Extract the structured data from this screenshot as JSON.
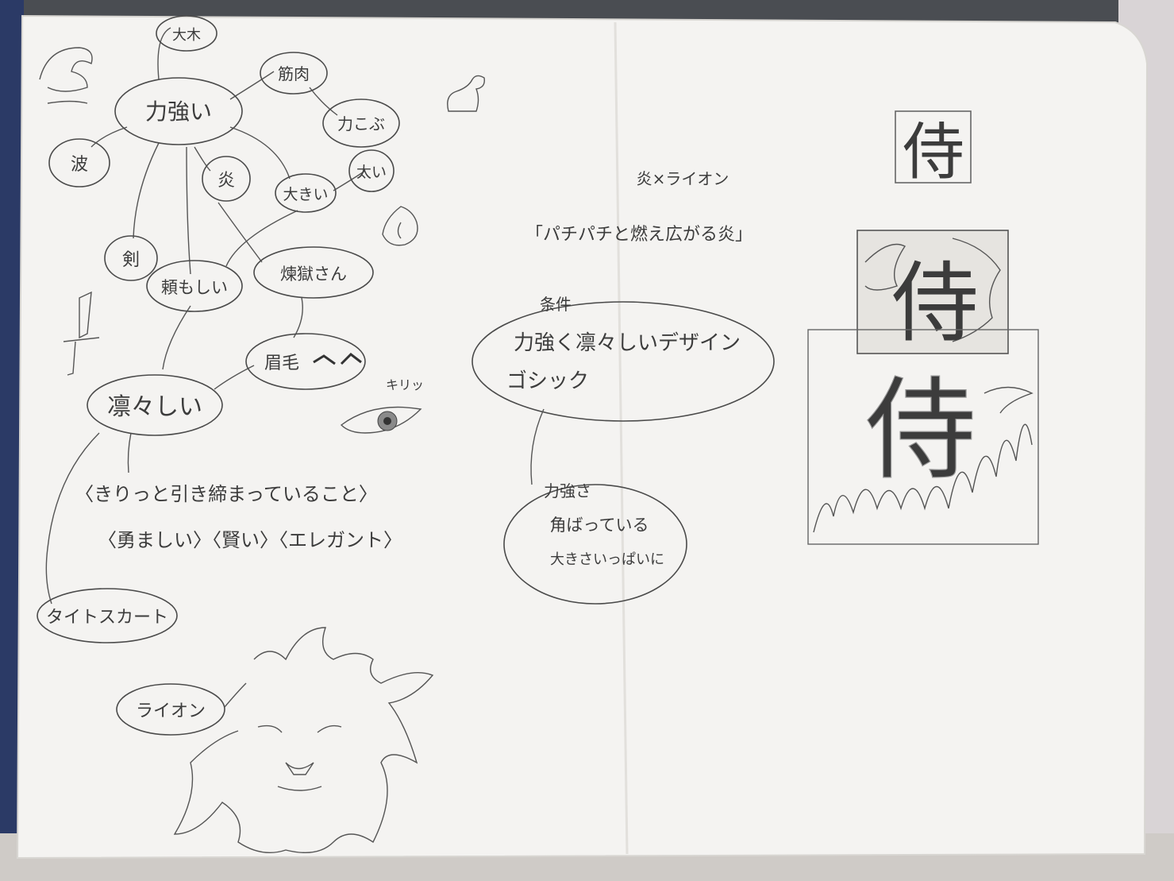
{
  "mindmap": {
    "center": "力強い",
    "n_taiboku": "大木",
    "n_kinniku": "筋肉",
    "n_chikarakobu": "力こぶ",
    "n_nami": "波",
    "n_honoo": "炎",
    "n_ookii": "大きい",
    "n_futoi": "太い",
    "n_tsurugi": "剣",
    "n_tanomoshii": "頼もしい",
    "n_rengoku": "煉獄さん",
    "n_mayuge": "眉毛",
    "n_riri": "凛々しい",
    "n_tight": "タイトスカート",
    "n_lion": "ライオン",
    "kiri_label": "キリッ",
    "phrase1": "〈きりっと引き締まっていること〉",
    "phrase2": "〈勇ましい〉〈賢い〉〈エレガント〉"
  },
  "middle": {
    "heading": "炎×ライオン",
    "quote": "「パチパチと燃え広がる炎」",
    "conditions_label": "条件",
    "conditions_line1": "力強く凛々しいデザイン",
    "conditions_line2": "ゴシック",
    "strength_label": "力強さ",
    "strength_line1": "角ばっている",
    "strength_line2": "大きさいっぱいに"
  },
  "right": {
    "samurai_glyph": "侍"
  }
}
